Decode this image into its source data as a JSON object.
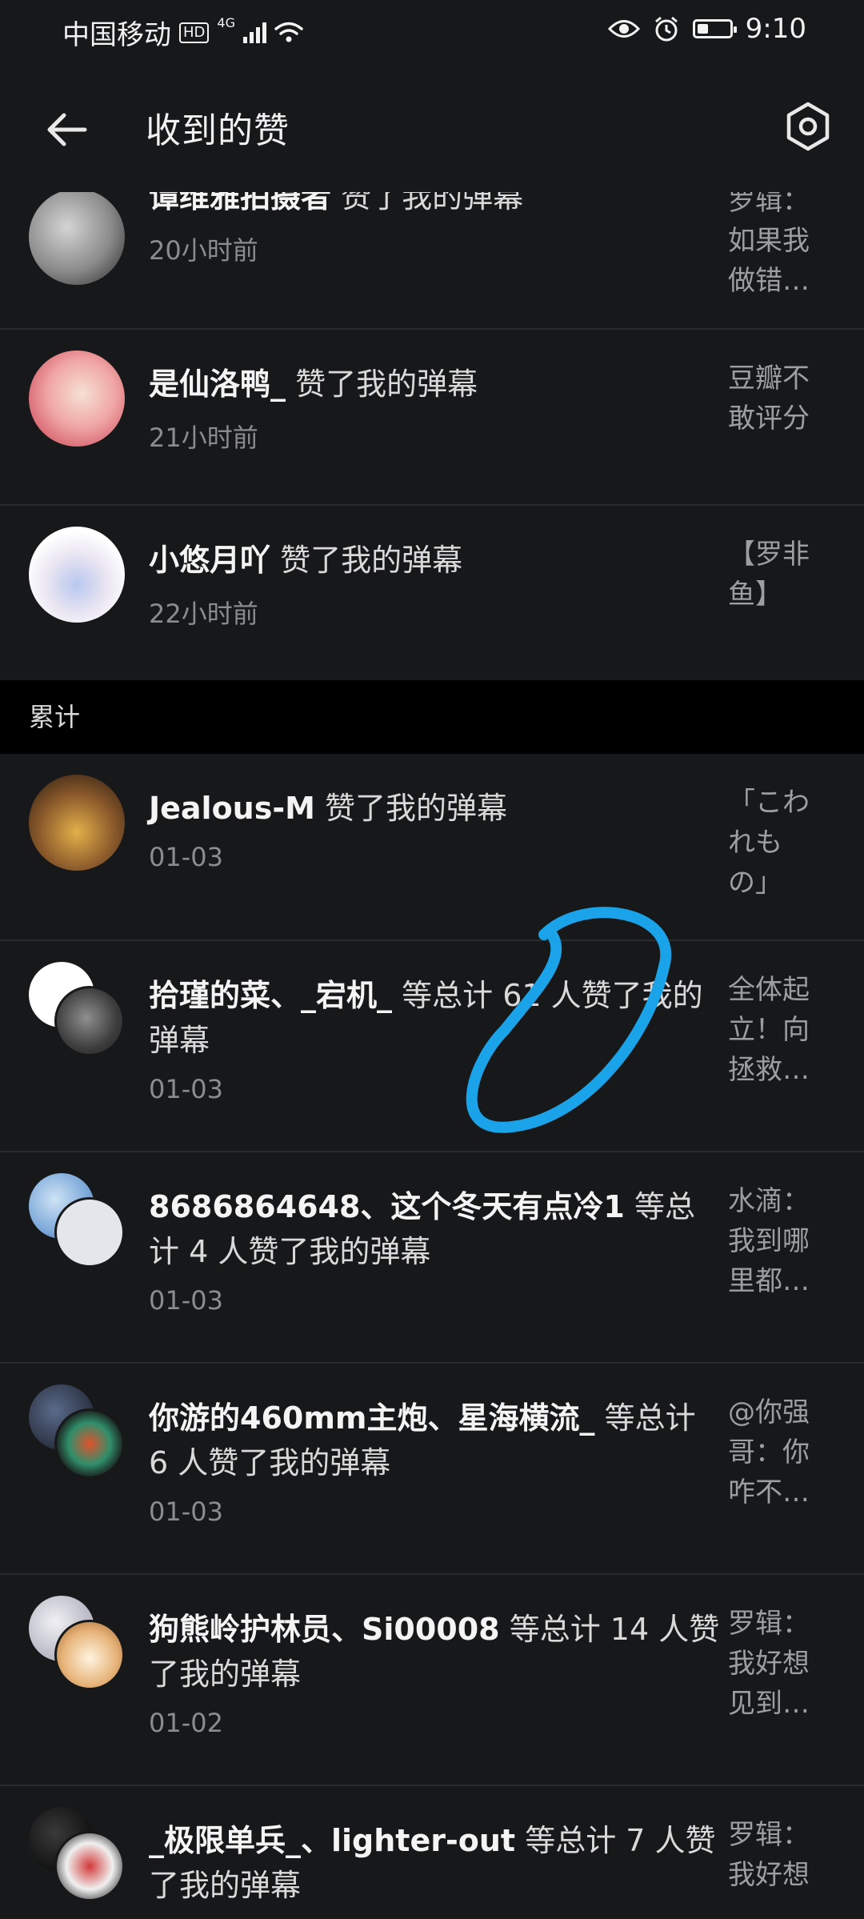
{
  "status_bar": {
    "carrier": "中国移动",
    "hd": "HD",
    "network": "4G",
    "time": "9:10",
    "battery_level": 0.35
  },
  "header": {
    "title": "收到的赞"
  },
  "recent_items": [
    {
      "user": "谭维雅拍摄者",
      "action": "赞了我的弹幕",
      "time": "20小时前",
      "quote": "罗辑：如果我做错…"
    },
    {
      "user": "是仙洛鸭_",
      "action": "赞了我的弹幕",
      "time": "21小时前",
      "quote": "豆瓣不敢评分"
    },
    {
      "user": "小悠月吖",
      "action": "赞了我的弹幕",
      "time": "22小时前",
      "quote": "【罗非鱼】"
    }
  ],
  "section": {
    "label": "累计"
  },
  "cumulative_items": [
    {
      "user": "Jealous-M",
      "action": "赞了我的弹幕",
      "time": "01-03",
      "quote": "「こわれもの」"
    },
    {
      "user": "拾瑾的菜、_宕机_",
      "action": "等总计 61 人赞了我的弹幕",
      "time": "01-03",
      "quote": "全体起立！向拯救…"
    },
    {
      "user": "8686864648、这个冬天有点冷1",
      "action": "等总计 4 人赞了我的弹幕",
      "time": "01-03",
      "quote": "水滴：我到哪里都…"
    },
    {
      "user": "你游的460mm主炮、星海横流_",
      "action": "等总计 6 人赞了我的弹幕",
      "time": "01-03",
      "quote": "@你强哥：你咋不…"
    },
    {
      "user": "狗熊岭护林员、Si00008",
      "action": "等总计 14 人赞了我的弹幕",
      "time": "01-02",
      "quote": "罗辑：我好想见到…"
    },
    {
      "user": "_极限单兵_、lighter-out",
      "action": "等总计 7 人赞了我的弹幕",
      "time": "",
      "quote": "罗辑：我好想"
    }
  ],
  "colors": {
    "background": "#17181a",
    "divider": "#2a2b2e",
    "section_bg": "#000000",
    "annotation": "#1aa3e8"
  }
}
